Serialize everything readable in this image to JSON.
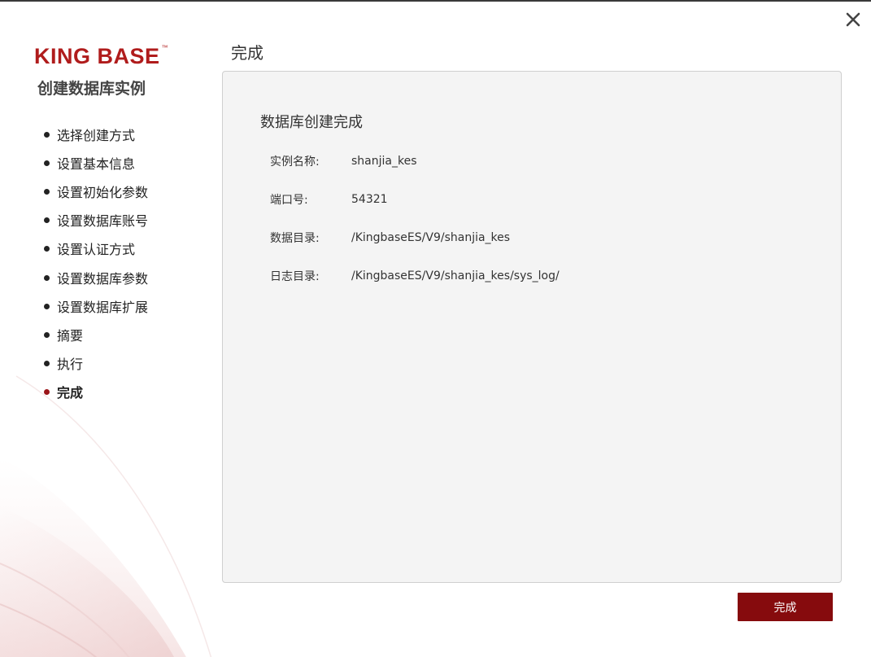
{
  "logo": {
    "text": "KING BASE",
    "tm": "™",
    "color": "#b01c1c"
  },
  "app_title": "创建数据库实例",
  "steps": [
    {
      "label": "选择创建方式",
      "active": false
    },
    {
      "label": "设置基本信息",
      "active": false
    },
    {
      "label": "设置初始化参数",
      "active": false
    },
    {
      "label": "设置数据库账号",
      "active": false
    },
    {
      "label": "设置认证方式",
      "active": false
    },
    {
      "label": "设置数据库参数",
      "active": false
    },
    {
      "label": "设置数据库扩展",
      "active": false
    },
    {
      "label": "摘要",
      "active": false
    },
    {
      "label": "执行",
      "active": false
    },
    {
      "label": "完成",
      "active": true
    }
  ],
  "page_title": "完成",
  "panel": {
    "heading": "数据库创建完成",
    "rows": [
      {
        "label": "实例名称:",
        "value": "shanjia_kes"
      },
      {
        "label": "端口号:",
        "value": "54321"
      },
      {
        "label": "数据目录:",
        "value": "/KingbaseES/V9/shanjia_kes"
      },
      {
        "label": "日志目录:",
        "value": "/KingbaseES/V9/shanjia_kes/sys_log/"
      }
    ]
  },
  "buttons": {
    "finish_label": "完成"
  },
  "icons": {
    "close": "close-icon"
  },
  "colors": {
    "accent": "#860b0d",
    "active_dot": "#9b1418",
    "panel_bg": "#f4f4f4"
  }
}
